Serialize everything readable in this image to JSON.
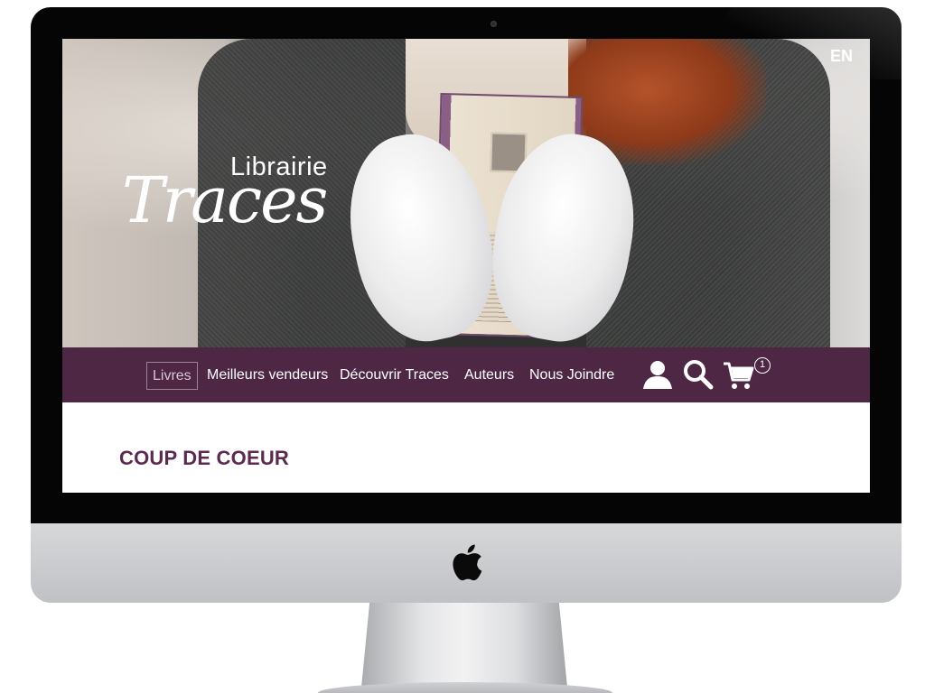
{
  "hero": {
    "brand_small": "Librairie",
    "brand_big": "Traces",
    "lang_toggle": "EN"
  },
  "nav": {
    "items": [
      {
        "label": "Livres",
        "active": true
      },
      {
        "label": "Meilleurs vendeurs",
        "active": false
      },
      {
        "label": "Découvrir Traces",
        "active": false
      },
      {
        "label": "Auteurs",
        "active": false
      },
      {
        "label": "Nous Joindre",
        "active": false
      }
    ],
    "icons": [
      "user-icon",
      "search-icon",
      "cart-icon"
    ],
    "cart_count": "1"
  },
  "content": {
    "section_title": "COUP DE COEUR"
  },
  "colors": {
    "nav_background": "#4e2745",
    "title_color": "#5b2b4f",
    "bezel": "#050505",
    "chin": "#c9cbce"
  }
}
